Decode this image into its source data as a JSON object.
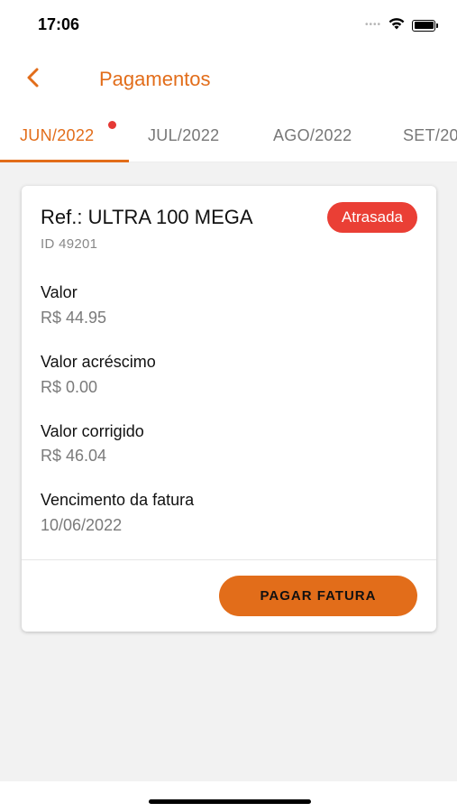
{
  "status_bar": {
    "time": "17:06",
    "signal_icon": "signal-dots-icon",
    "wifi_icon": "wifi-icon",
    "battery_icon": "battery-icon",
    "battery_level": 1.0
  },
  "header": {
    "back_icon": "chevron-left-icon",
    "title": "Pagamentos"
  },
  "tabs": [
    {
      "label": "JUN/2022",
      "active": true,
      "has_notification": true
    },
    {
      "label": "JUL/2022",
      "active": false
    },
    {
      "label": "AGO/2022",
      "active": false
    },
    {
      "label": "SET/20",
      "active": false
    }
  ],
  "invoice": {
    "title": "Ref.: ULTRA 100 MEGA",
    "id": "ID 49201",
    "status": "Atrasada",
    "fields": [
      {
        "label": "Valor",
        "value": "R$ 44.95"
      },
      {
        "label": "Valor acréscimo",
        "value": "R$ 0.00"
      },
      {
        "label": "Valor corrigido",
        "value": "R$ 46.04"
      },
      {
        "label": "Vencimento da fatura",
        "value": "10/06/2022"
      }
    ],
    "pay_button_label": "PAGAR FATURA"
  },
  "colors": {
    "accent": "#e26d1a",
    "badge_red": "#ea3f35",
    "notification_dot": "#e53935",
    "background": "#f2f2f2"
  }
}
